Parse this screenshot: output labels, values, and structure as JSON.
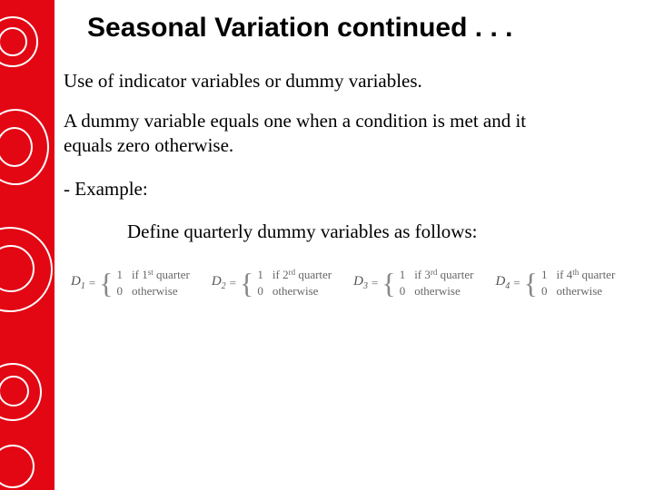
{
  "title": "Seasonal Variation continued . . .",
  "subhead": "Use of indicator variables or dummy variables.",
  "para": "A dummy variable equals one when a condition is met and it equals zero otherwise.",
  "example_label": "- Example:",
  "define": "Define quarterly dummy variables as follows:",
  "dummies": [
    {
      "name_html": "D",
      "sub": "1",
      "top": "1",
      "top_cond": "if 1",
      "ord": "st",
      "tail": " quarter",
      "bot": "0",
      "bot_cond": "otherwise"
    },
    {
      "name_html": "D",
      "sub": "2",
      "top": "1",
      "top_cond": "if 2",
      "ord": "rd",
      "tail": " quarter",
      "bot": "0",
      "bot_cond": "otherwise"
    },
    {
      "name_html": "D",
      "sub": "3",
      "top": "1",
      "top_cond": "if 3",
      "ord": "rd",
      "tail": " quarter",
      "bot": "0",
      "bot_cond": "otherwise"
    },
    {
      "name_html": "D",
      "sub": "4",
      "top": "1",
      "top_cond": "if 4",
      "ord": "th",
      "tail": " quarter",
      "bot": "0",
      "bot_cond": "otherwise"
    }
  ]
}
